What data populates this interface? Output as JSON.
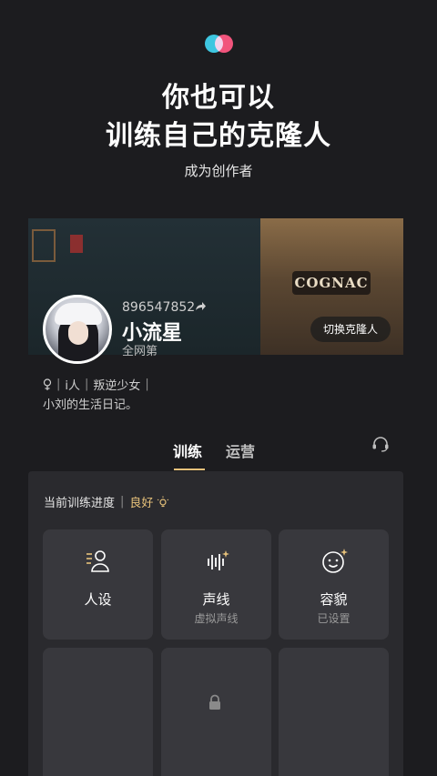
{
  "header": {
    "line1": "你也可以",
    "line2": "训练自己的克隆人",
    "cta": "成为创作者"
  },
  "profile": {
    "uid": "896547852",
    "name": "小流星",
    "rank": "全网第",
    "tags": [
      "i人",
      "叛逆少女"
    ],
    "bio": "小刘的生活日记。",
    "switch_label": "切换克隆人",
    "banner_sign": "COGNAC"
  },
  "tabs": [
    {
      "label": "训练",
      "active": true
    },
    {
      "label": "运营",
      "active": false
    }
  ],
  "training": {
    "progress_label": "当前训练进度",
    "progress_value": "良好",
    "cards": [
      {
        "title": "人设",
        "subtitle": "",
        "icon": "persona-icon"
      },
      {
        "title": "声线",
        "subtitle": "虚拟声线",
        "icon": "voice-wave-icon"
      },
      {
        "title": "容貌",
        "subtitle": "已设置",
        "icon": "face-sparkle-icon"
      }
    ]
  },
  "colors": {
    "accent": "#e6c17a",
    "background": "#1c1c1f",
    "card": "#38383d",
    "logo_a": "#3ec6e0",
    "logo_b": "#ef3f6a"
  }
}
